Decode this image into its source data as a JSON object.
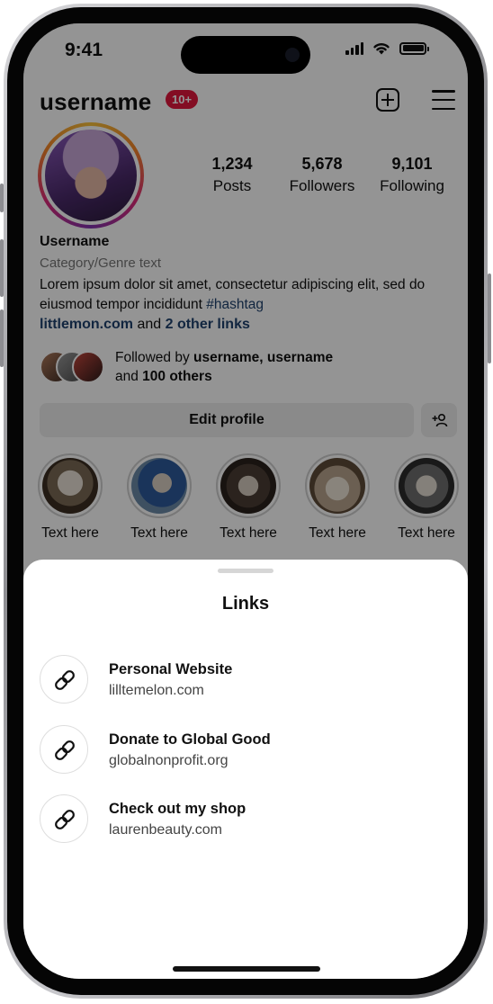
{
  "status_bar": {
    "time": "9:41"
  },
  "header": {
    "username": "username",
    "badge": "10+"
  },
  "stats": [
    {
      "value": "1,234",
      "label": "Posts"
    },
    {
      "value": "5,678",
      "label": "Followers"
    },
    {
      "value": "9,101",
      "label": "Following"
    }
  ],
  "bio": {
    "name": "Username",
    "category": "Category/Genre text",
    "text": "Lorem ipsum dolor sit amet, consectetur adipiscing elit, sed do eiusmod tempor incididunt ",
    "hashtag": "#hashtag",
    "link_primary": "littlemon.com",
    "link_joiner": " and ",
    "link_more": "2 other links"
  },
  "followed_by": {
    "prefix": "Followed by ",
    "names": "username, username",
    "mid": "and ",
    "others": "100 others"
  },
  "edit_profile_label": "Edit profile",
  "highlights": [
    {
      "label": "Text  here"
    },
    {
      "label": "Text  here"
    },
    {
      "label": "Text  here"
    },
    {
      "label": "Text  here"
    },
    {
      "label": "Text  here"
    }
  ],
  "sheet": {
    "title": "Links",
    "links": [
      {
        "title": "Personal Website",
        "url": "lilltemelon.com"
      },
      {
        "title": "Donate to Global Good",
        "url": "globalnonprofit.org"
      },
      {
        "title": "Check out my shop",
        "url": "laurenbeauty.com"
      }
    ]
  },
  "colors": {
    "badge": "#e2173d",
    "link_blue": "#20436e",
    "overlay": "rgba(0,0,0,0.42)"
  },
  "icons": [
    "add-post-icon",
    "menu-icon",
    "add-person-icon",
    "link-icon"
  ]
}
